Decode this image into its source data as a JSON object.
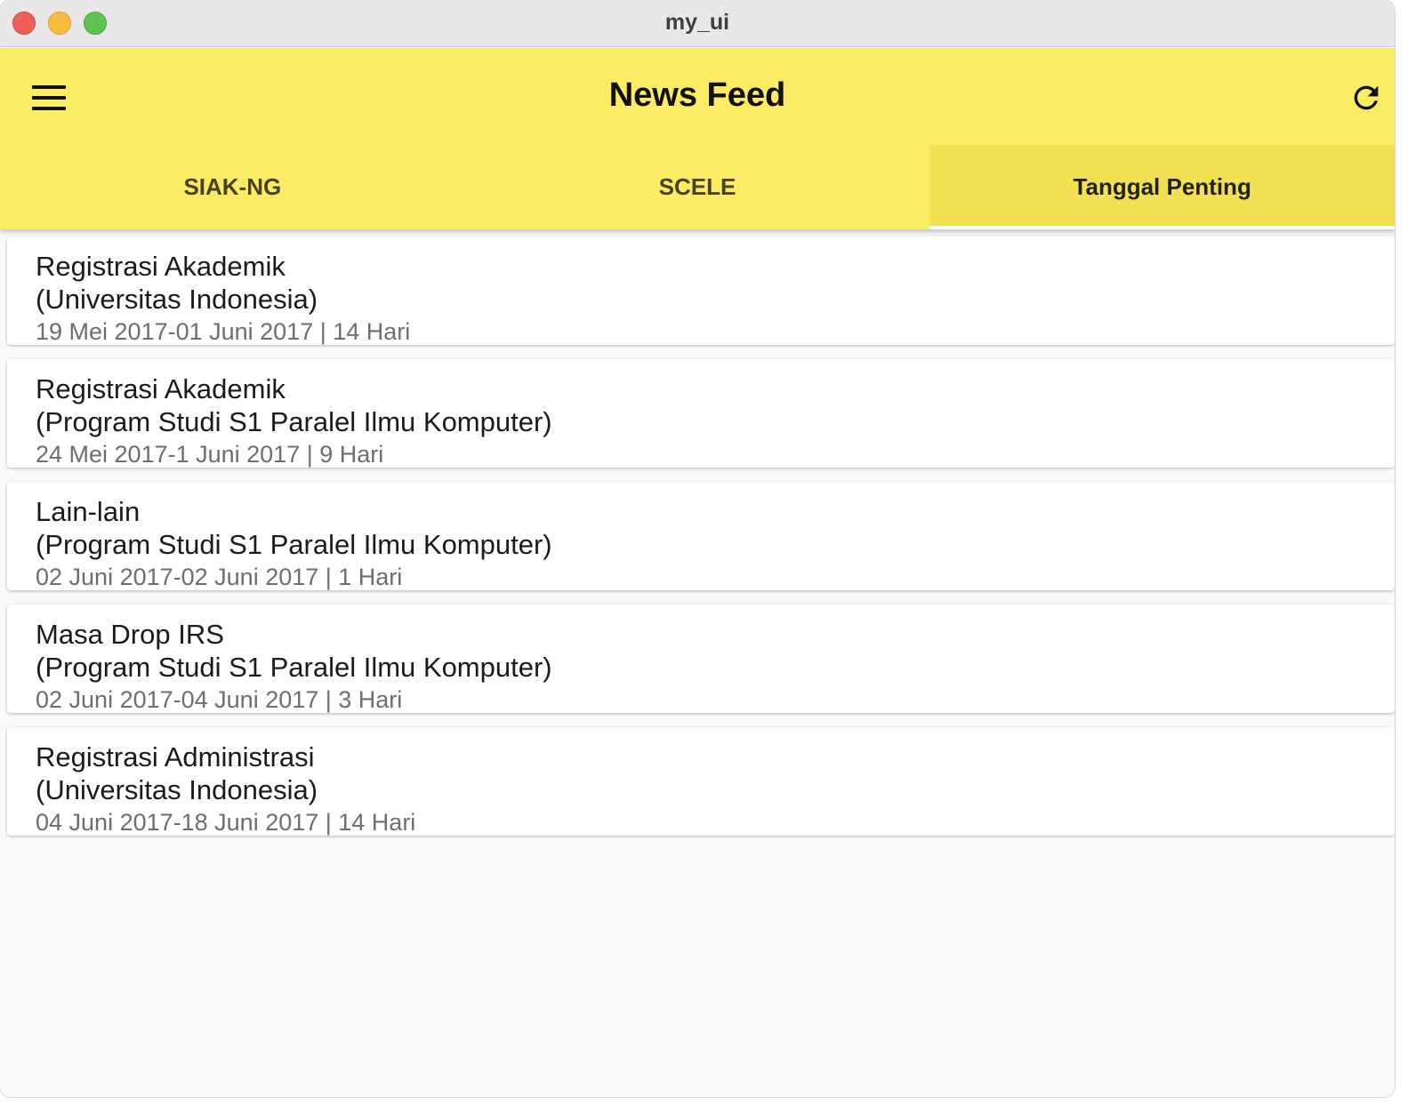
{
  "window": {
    "title": "my_ui"
  },
  "appbar": {
    "title": "News Feed",
    "menu_icon": "menu-icon",
    "refresh_icon": "refresh-icon"
  },
  "tabs": [
    {
      "label": "SIAK-NG",
      "active": false
    },
    {
      "label": "SCELE",
      "active": false
    },
    {
      "label": "Tanggal Penting",
      "active": true
    }
  ],
  "colors": {
    "appbar": "#fbeb65",
    "active_tab": "#f2e153",
    "indicator": "#ffffff",
    "meta_text": "#6e6e6e"
  },
  "events": [
    {
      "title": "Registrasi Akademik",
      "subtitle": "(Universitas Indonesia)",
      "meta": "19 Mei 2017-01 Juni 2017  | 14 Hari"
    },
    {
      "title": "Registrasi Akademik",
      "subtitle": "(Program Studi S1 Paralel Ilmu Komputer)",
      "meta": "24 Mei 2017-1 Juni 2017  | 9 Hari"
    },
    {
      "title": "Lain-lain",
      "subtitle": "(Program Studi S1 Paralel Ilmu Komputer)",
      "meta": "02 Juni 2017-02 Juni 2017  | 1 Hari"
    },
    {
      "title": "Masa Drop IRS",
      "subtitle": "(Program Studi S1 Paralel Ilmu Komputer)",
      "meta": "02 Juni 2017-04 Juni 2017  | 3 Hari"
    },
    {
      "title": "Registrasi Administrasi",
      "subtitle": "(Universitas Indonesia)",
      "meta": "04 Juni 2017-18 Juni 2017  | 14 Hari"
    }
  ]
}
